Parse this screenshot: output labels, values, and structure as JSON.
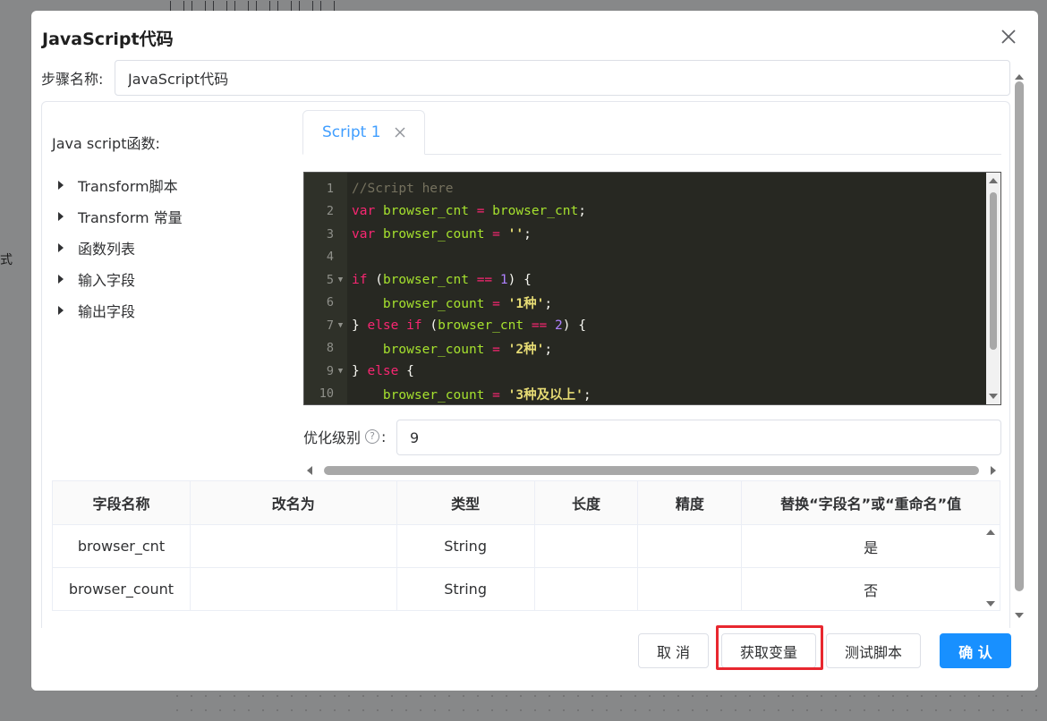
{
  "background": {
    "left_text": "式"
  },
  "dialog": {
    "title": "JavaScript代码",
    "close_icon": "close-icon",
    "step_label": "步骤名称:",
    "step_value": "JavaScript代码"
  },
  "functions": {
    "title": "Java script函数:",
    "items": [
      {
        "label": "Transform脚本"
      },
      {
        "label": "Transform 常量"
      },
      {
        "label": "函数列表"
      },
      {
        "label": "输入字段"
      },
      {
        "label": "输出字段"
      }
    ]
  },
  "tabs": [
    {
      "label": "Script 1",
      "active": true
    }
  ],
  "editor": {
    "lines": [
      {
        "n": "1",
        "text": "//Script here"
      },
      {
        "n": "2",
        "text": "var browser_cnt = browser_cnt;"
      },
      {
        "n": "3",
        "text": "var browser_count = '';"
      },
      {
        "n": "4",
        "text": ""
      },
      {
        "n": "5",
        "text": "if (browser_cnt == 1) {"
      },
      {
        "n": "6",
        "text": "    browser_count = '1种';"
      },
      {
        "n": "7",
        "text": "} else if (browser_cnt == 2) {"
      },
      {
        "n": "8",
        "text": "    browser_count = '2种';"
      },
      {
        "n": "9",
        "text": "} else {"
      },
      {
        "n": "10",
        "text": "    browser_count = '3种及以上';"
      }
    ]
  },
  "optimize": {
    "label": "优化级别",
    "colon": ":",
    "help_icon": "?",
    "value": "9"
  },
  "table": {
    "headers": [
      "字段名称",
      "改名为",
      "类型",
      "长度",
      "精度",
      "替换“字段名”或“重命名”值"
    ],
    "rows": [
      [
        "browser_cnt",
        "",
        "String",
        "",
        "",
        "是"
      ],
      [
        "browser_count",
        "",
        "String",
        "",
        "",
        "否"
      ]
    ]
  },
  "footer": {
    "cancel": "取 消",
    "get_vars": "获取变量",
    "test_script": "测试脚本",
    "confirm": "确 认"
  },
  "colors": {
    "primary": "#1890ff",
    "tab_active": "#409eff",
    "highlight": "#e8272f"
  }
}
